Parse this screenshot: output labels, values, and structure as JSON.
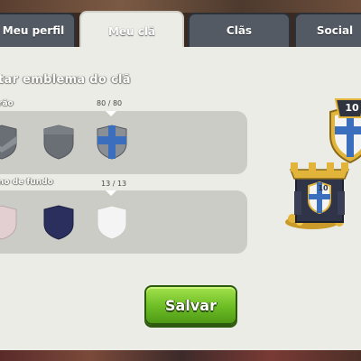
{
  "tabs": [
    {
      "label": "Meu perfil",
      "active": false
    },
    {
      "label": "Meu clã",
      "active": true
    },
    {
      "label": "Clãs",
      "active": false
    },
    {
      "label": "Social",
      "active": false
    }
  ],
  "title": "tar emblema do clã",
  "pattern_section": {
    "label": "rão",
    "counter": "80 / 80",
    "selected_index": 2,
    "swatches": [
      {
        "name": "chevron-pattern",
        "color": "#6a6f76"
      },
      {
        "name": "plain-pattern",
        "color": "#6a6f76"
      },
      {
        "name": "cross-pattern",
        "color": "#3b6fbd"
      }
    ]
  },
  "background_section": {
    "label": "no de fundo",
    "counter": "13 / 13",
    "selected_index": 2,
    "swatches": [
      {
        "name": "pink-background",
        "color": "#e3cfd2"
      },
      {
        "name": "navy-background",
        "color": "#2a2f5e"
      },
      {
        "name": "white-background",
        "color": "#f4f4f4"
      }
    ]
  },
  "preview": {
    "badge_level": "10",
    "castle_level": "10"
  },
  "save_label": "Salvar",
  "colors": {
    "accent_green": "#6cbd25",
    "emblem_blue": "#3b6fbd",
    "gold": "#e2b53a"
  }
}
